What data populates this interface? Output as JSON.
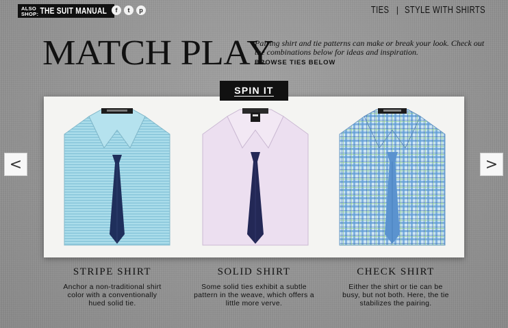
{
  "topbar": {
    "also_shop": "ALSO SHOP:",
    "brand": "THE SUIT MANUAL",
    "social": [
      {
        "icon": "facebook-icon",
        "glyph": "f"
      },
      {
        "icon": "twitter-icon",
        "glyph": "t"
      },
      {
        "icon": "pinterest-icon",
        "glyph": "p"
      }
    ],
    "nav": {
      "ties": "TIES",
      "separator": "|",
      "style_with_shirts": "STYLE WITH SHIRTS"
    }
  },
  "hero": {
    "title": "MATCH PLAY",
    "intro": "Pairing shirt and tie patterns can make or break your look. Check out the combinations below for ideas and inspiration.",
    "browse": "BROWSE TIES BELOW"
  },
  "spin_label": "SPIN IT",
  "arrows": {
    "prev": "<",
    "next": ">"
  },
  "pairings": [
    {
      "title": "STRIPE SHIRT",
      "description": "Anchor a non-traditional shirt color with a conventionally hued solid tie.",
      "shirt_color": "#9fd3e2",
      "tie_color": "#1f2f5c"
    },
    {
      "title": "SOLID SHIRT",
      "description": "Some solid ties exhibit a subtle pattern in the weave, which offers a little more verve.",
      "shirt_color": "#e9dcef",
      "tie_color": "#232856"
    },
    {
      "title": "CHECK SHIRT",
      "description": "Either the shirt or tie can be busy, but not both. Here, the tie stabilizes the pairing.",
      "shirt_color": "#a9cfe8",
      "tie_color": "#5b93cf"
    }
  ]
}
